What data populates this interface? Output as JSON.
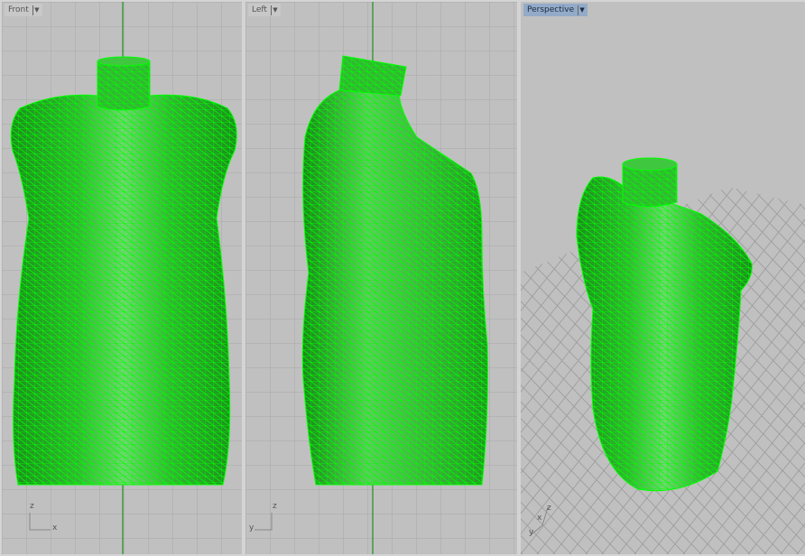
{
  "viewports": [
    {
      "label": "Front",
      "active": false,
      "axes": {
        "vertical": "z",
        "horizontal": "x"
      }
    },
    {
      "label": "Left",
      "active": false,
      "axes": {
        "vertical": "z",
        "horizontal": "y"
      }
    },
    {
      "label": "Perspective",
      "active": true,
      "axes": {
        "a": "z",
        "b": "x",
        "c": "y"
      }
    }
  ],
  "colors": {
    "background": "#c0c0c0",
    "grid": "#a9a9a9",
    "axis_line": "#3a9a3a",
    "mesh": "#00ff00",
    "surface": "#2fbf2f",
    "active_tab": "#93abc8"
  },
  "dropdown_icon": "triangle-down"
}
